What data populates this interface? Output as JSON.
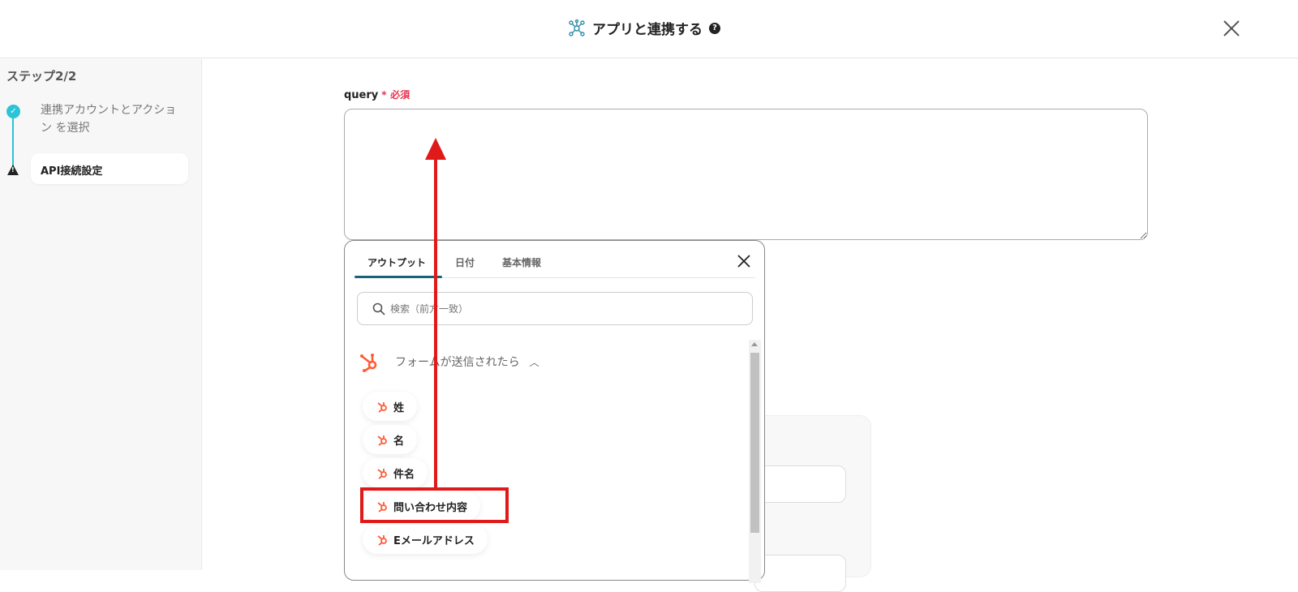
{
  "header": {
    "title": "アプリと連携する",
    "help_icon": "?"
  },
  "sidebar": {
    "step_title": "ステップ2/2",
    "steps": [
      {
        "label": "連携アカウントとアクション を選択",
        "status": "done"
      },
      {
        "label": "API接続設定",
        "status": "warning"
      }
    ]
  },
  "form": {
    "field_label": "query",
    "required_mark": "*",
    "required_text": "必須",
    "value": ""
  },
  "popup": {
    "tabs": [
      "アウトプット",
      "日付",
      "基本情報"
    ],
    "active_tab": 0,
    "search_placeholder": "検索（前方一致）",
    "group_label": "フォームが送信されたら",
    "items": [
      "姓",
      "名",
      "件名",
      "問い合わせ内容",
      "Eメールアドレス"
    ],
    "highlighted_item": "問い合わせ内容"
  },
  "colors": {
    "accent": "#16637a",
    "hubspot": "#ff5c35",
    "annotation": "#e01919",
    "step": "#2bc4d6"
  }
}
